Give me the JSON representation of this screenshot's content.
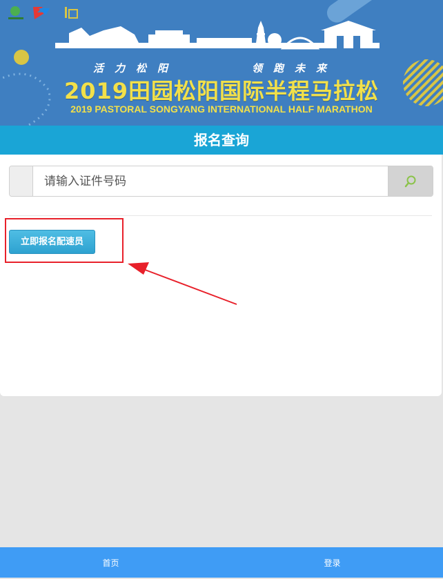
{
  "banner": {
    "tagline_left": "活力松阳",
    "tagline_right": "领跑未来",
    "title_zh": "2019田园松阳国际半程马拉松",
    "title_en": "2019 PASTORAL SONGYANG INTERNATIONAL HALF MARATHON"
  },
  "section": {
    "title": "报名查询"
  },
  "search": {
    "placeholder": "请输入证件号码",
    "value": "",
    "icon": "search-icon"
  },
  "signup_button": {
    "label": "立即报名配速员"
  },
  "bottom_nav": {
    "items": [
      {
        "label": "首页"
      },
      {
        "label": "登录"
      }
    ]
  },
  "colors": {
    "banner_bg": "#3f7fc1",
    "section_bar": "#1aa5d6",
    "title_yellow": "#f2e04a",
    "nav_bg": "#3f9cf5",
    "annotation_red": "#e8202a"
  }
}
